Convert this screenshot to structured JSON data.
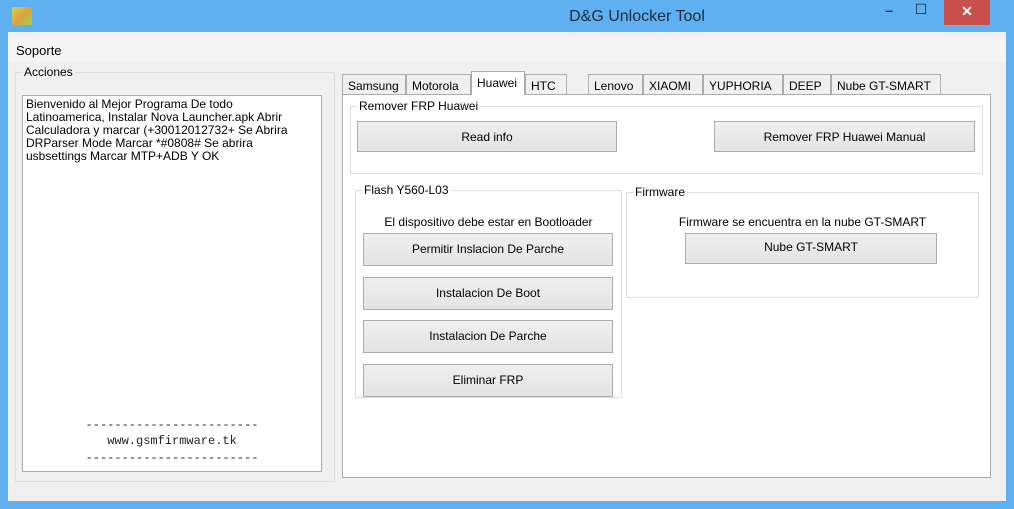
{
  "window": {
    "title": "D&G Unlocker Tool",
    "minimize": "–",
    "maximize": "☐",
    "close": "✕"
  },
  "menu": {
    "soporte": "Soporte"
  },
  "acciones": {
    "label": "Acciones",
    "text": "Bienvenido al Mejor Programa De todo Latinoamerica, Instalar Nova Launcher.apk  Abrir Calculadora y marcar (+30012012732+  Se Abrira DRParser Mode Marcar *#0808# Se abrira usbsettings Marcar MTP+ADB Y OK",
    "dashes": "------------------------",
    "site": "www.gsmfirmware.tk"
  },
  "tabs": [
    "Samsung",
    "Motorola",
    "Huawei",
    "HTC",
    "Lenovo",
    "XIAOMI",
    "YUPHORIA",
    "DEEP",
    "Nube GT-SMART"
  ],
  "remover": {
    "label": "Remover FRP Huawei",
    "read_info": "Read info",
    "manual": "Remover FRP Huawei Manual"
  },
  "flash": {
    "label": "Flash Y560-L03",
    "note": "El dispositivo debe estar en Bootloader",
    "buttons": [
      "Permitir Inslacion De Parche",
      "Instalacion De Boot",
      "Instalacion De Parche",
      "Eliminar FRP"
    ]
  },
  "firmware": {
    "label": "Firmware",
    "note": "Firmware se encuentra en la nube GT-SMART",
    "button": "Nube GT-SMART"
  }
}
